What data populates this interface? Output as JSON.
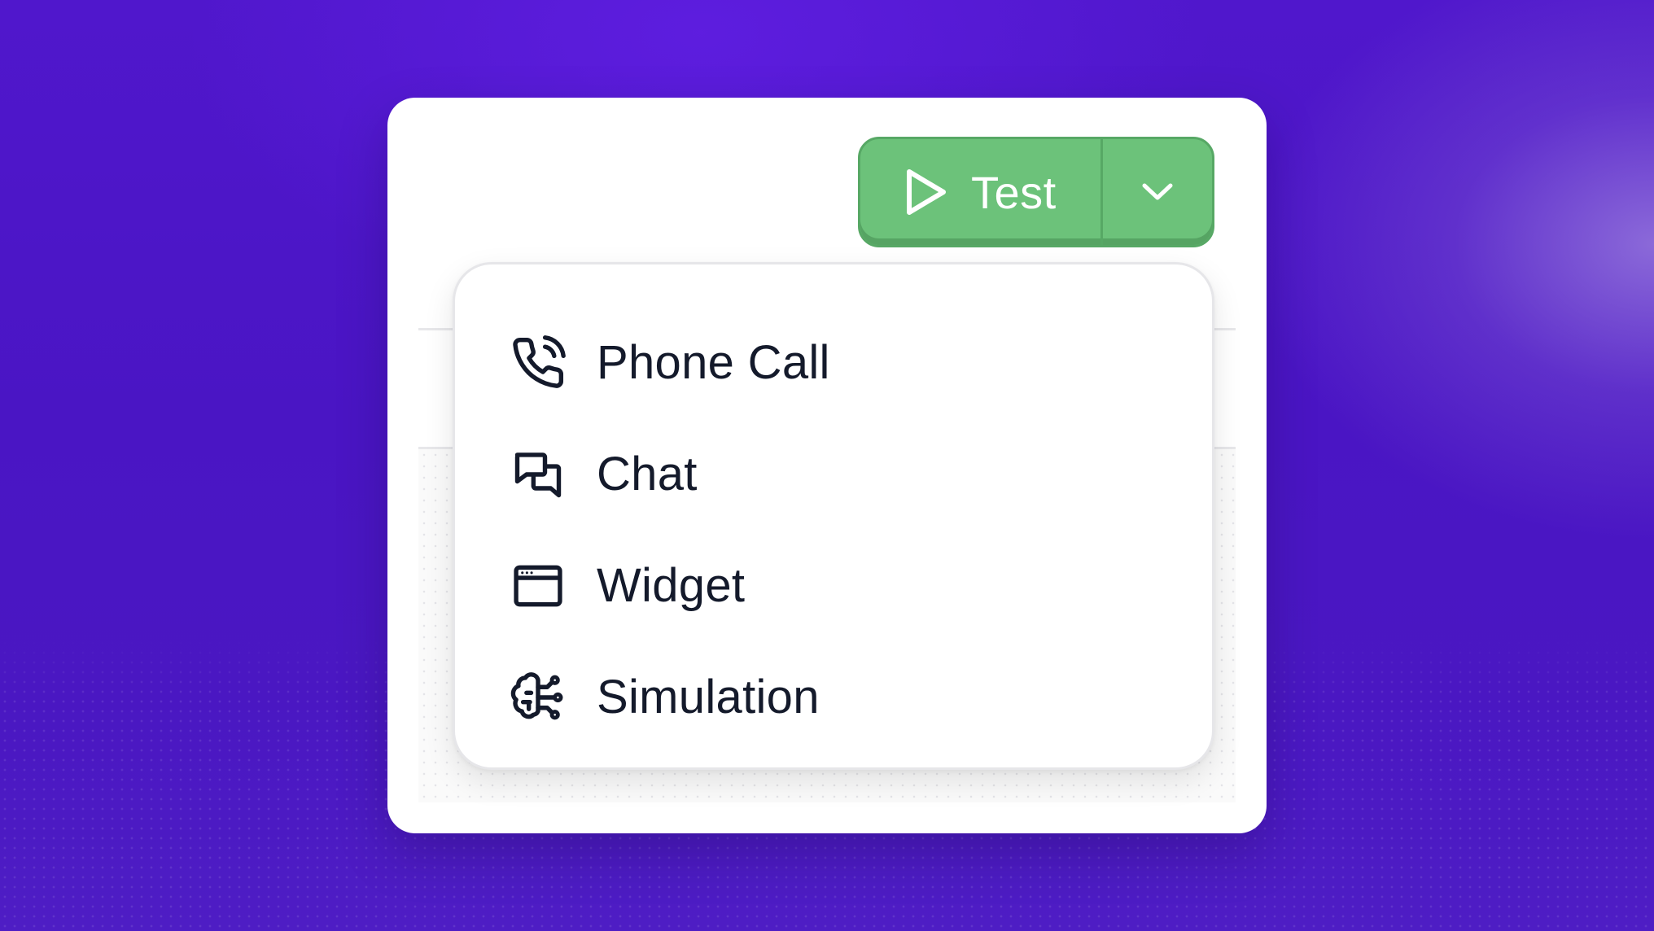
{
  "test_button": {
    "label": "Test",
    "icon": "play-icon",
    "dropdown_icon": "chevron-down-icon",
    "color": "#6cc27a"
  },
  "menu": {
    "items": [
      {
        "label": "Phone Call",
        "icon": "phone-call-icon"
      },
      {
        "label": "Chat",
        "icon": "chat-bubbles-icon"
      },
      {
        "label": "Widget",
        "icon": "browser-window-icon"
      },
      {
        "label": "Simulation",
        "icon": "brain-circuit-icon"
      }
    ]
  },
  "colors": {
    "background": "#4a16c6",
    "text": "#141a2b",
    "accent": "#6cc27a"
  }
}
